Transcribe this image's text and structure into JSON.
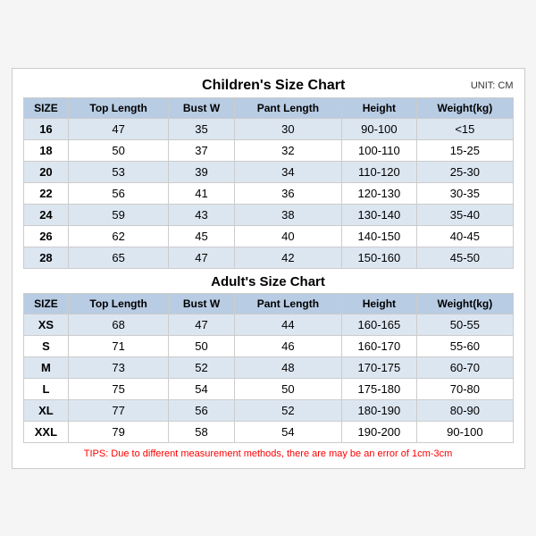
{
  "title": "Children's Size Chart",
  "unit": "UNIT: CM",
  "children_headers": [
    "SIZE",
    "Top Length",
    "Bust W",
    "Pant Length",
    "Height",
    "Weight(kg)"
  ],
  "children_rows": [
    [
      "16",
      "47",
      "35",
      "30",
      "90-100",
      "<15"
    ],
    [
      "18",
      "50",
      "37",
      "32",
      "100-110",
      "15-25"
    ],
    [
      "20",
      "53",
      "39",
      "34",
      "110-120",
      "25-30"
    ],
    [
      "22",
      "56",
      "41",
      "36",
      "120-130",
      "30-35"
    ],
    [
      "24",
      "59",
      "43",
      "38",
      "130-140",
      "35-40"
    ],
    [
      "26",
      "62",
      "45",
      "40",
      "140-150",
      "40-45"
    ],
    [
      "28",
      "65",
      "47",
      "42",
      "150-160",
      "45-50"
    ]
  ],
  "adults_title": "Adult's Size Chart",
  "adults_headers": [
    "SIZE",
    "Top Length",
    "Bust W",
    "Pant Length",
    "Height",
    "Weight(kg)"
  ],
  "adults_rows": [
    [
      "XS",
      "68",
      "47",
      "44",
      "160-165",
      "50-55"
    ],
    [
      "S",
      "71",
      "50",
      "46",
      "160-170",
      "55-60"
    ],
    [
      "M",
      "73",
      "52",
      "48",
      "170-175",
      "60-70"
    ],
    [
      "L",
      "75",
      "54",
      "50",
      "175-180",
      "70-80"
    ],
    [
      "XL",
      "77",
      "56",
      "52",
      "180-190",
      "80-90"
    ],
    [
      "XXL",
      "79",
      "58",
      "54",
      "190-200",
      "90-100"
    ]
  ],
  "tips": "TIPS: Due to different measurement methods, there are may be an error of 1cm-3cm"
}
